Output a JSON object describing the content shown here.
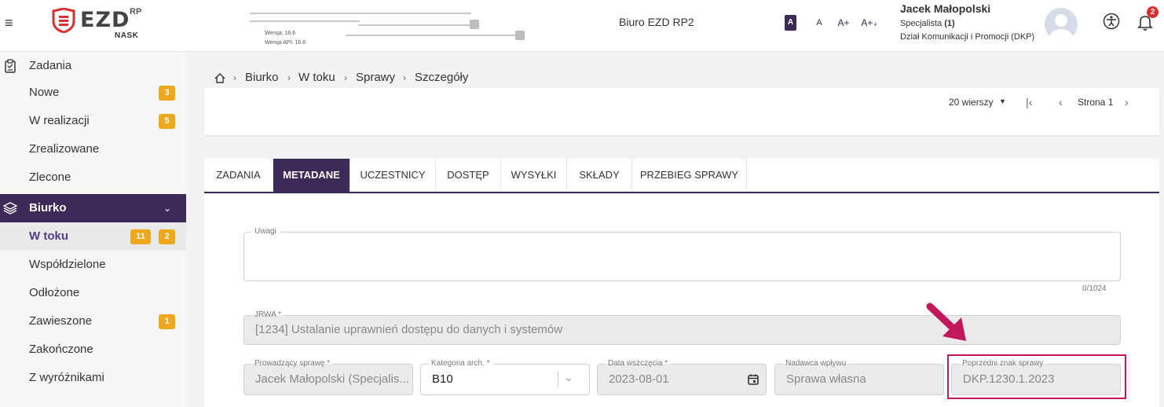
{
  "header": {
    "version": "Wersja: 16.6",
    "api_version": "Wersja API: 16.6",
    "app_title": "Biuro EZD RP2",
    "logo": {
      "main": "EZD",
      "sup": "RP",
      "sub": "NASK"
    },
    "font_sizes": [
      "A",
      "A",
      "A+",
      "A+₊"
    ],
    "user": {
      "name": "Jacek Małopolski",
      "role": "Specjalista",
      "role_count": "(1)",
      "department": "Dział Komunikacji i Promocji (DKP)"
    },
    "notifications_count": "2"
  },
  "sidebar": {
    "zadania": {
      "label": "Zadania",
      "icon": "clipboard-icon"
    },
    "zadania_items": [
      {
        "label": "Nowe",
        "count": "3"
      },
      {
        "label": "W realizacji",
        "count": "5"
      },
      {
        "label": "Zrealizowane"
      },
      {
        "label": "Zlecone"
      }
    ],
    "biurko": {
      "label": "Biurko",
      "icon": "layers-icon"
    },
    "biurko_items": [
      {
        "label": "W toku",
        "count": "11",
        "count2": "2"
      },
      {
        "label": "Współdzielone"
      },
      {
        "label": "Odłożone"
      },
      {
        "label": "Zawieszone",
        "count": "1"
      },
      {
        "label": "Zakończone"
      },
      {
        "label": "Z wyróżnikami"
      }
    ]
  },
  "breadcrumb": [
    "Biurko",
    "W toku",
    "Sprawy",
    "Szczegóły"
  ],
  "pager": {
    "rows": "20 wierszy",
    "page": "Strona 1"
  },
  "tabs": [
    "ZADANIA",
    "METADANE",
    "UCZESTNICY",
    "DOSTĘP",
    "WYSYŁKI",
    "SKŁADY",
    "PRZEBIEG SPRAWY"
  ],
  "form": {
    "uwagi": {
      "label": "Uwagi",
      "value": "",
      "counter": "0/1024"
    },
    "jrwa": {
      "label": "JRWA *",
      "value": "[1234] Ustalanie uprawnień dostępu do danych i systemów"
    },
    "prowadzacy": {
      "label": "Prowadzący sprawę *",
      "value": "Jacek Małopolski (Specjalis..."
    },
    "kategoria": {
      "label": "Kategoria arch. *",
      "value": "B10"
    },
    "data": {
      "label": "Data wszczęcia *",
      "value": "2023-08-01"
    },
    "nadawca": {
      "label": "Nadawca wpływu",
      "value": "Sprawa własna"
    },
    "poprzedni": {
      "label": "Poprzedni znak sprawy",
      "value": "DKP.1230.1.2023"
    }
  },
  "colors": {
    "primary": "#3d2a57",
    "badge": "#f0a81b",
    "highlight": "#c2185b"
  }
}
